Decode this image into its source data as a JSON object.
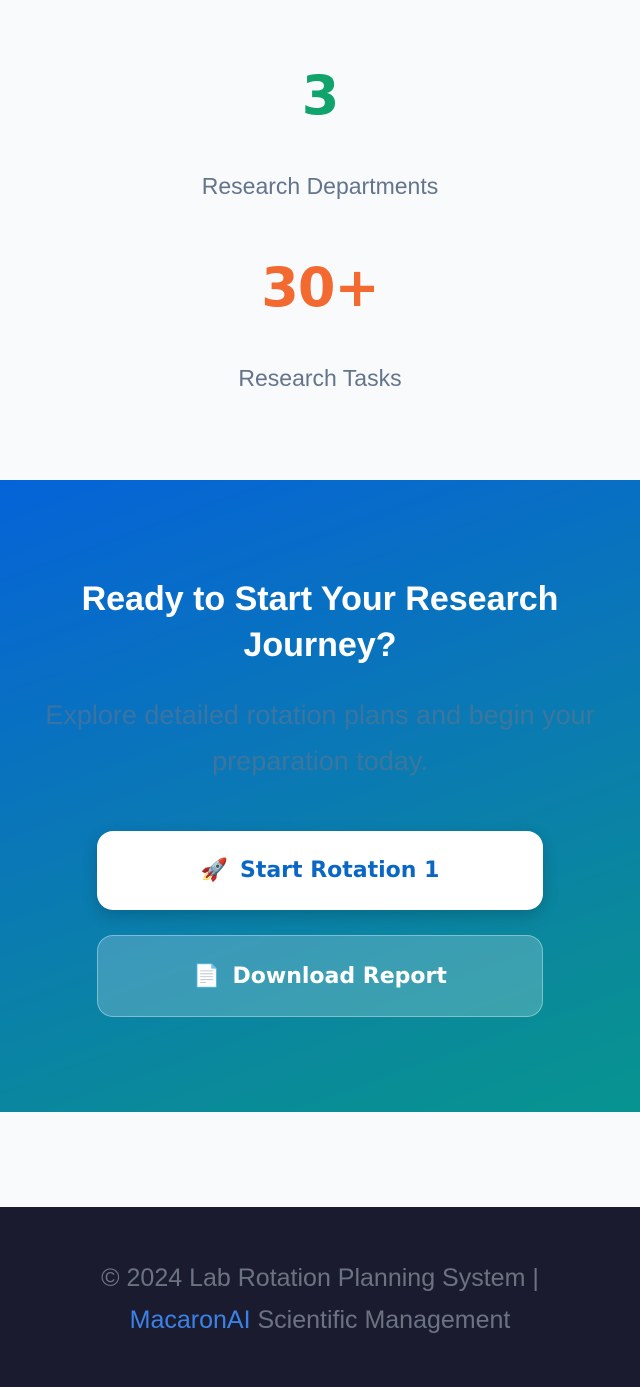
{
  "stats": [
    {
      "value": "3",
      "label": "Research Departments"
    },
    {
      "value": "30+",
      "label": "Research Tasks"
    }
  ],
  "cta": {
    "title": "Ready to Start Your Research Journey?",
    "subtitle": "Explore detailed rotation plans and begin your preparation today.",
    "primary_button": {
      "icon": "🚀",
      "label": "Start Rotation 1"
    },
    "secondary_button": {
      "icon": "📄",
      "label": "Download Report"
    }
  },
  "footer": {
    "copyright": "© 2024 Lab Rotation Planning System |",
    "brand": "MacaronAI",
    "tagline": "Scientific Management"
  },
  "colors": {
    "departments_value": "#10a36b",
    "tasks_value": "#f26a30",
    "cta_gradient_start": "#0563d8",
    "cta_gradient_end": "#079490",
    "primary_button_text": "#0a68c4",
    "footer_background": "#1a1b2e",
    "footer_brand": "#3b82e8"
  }
}
